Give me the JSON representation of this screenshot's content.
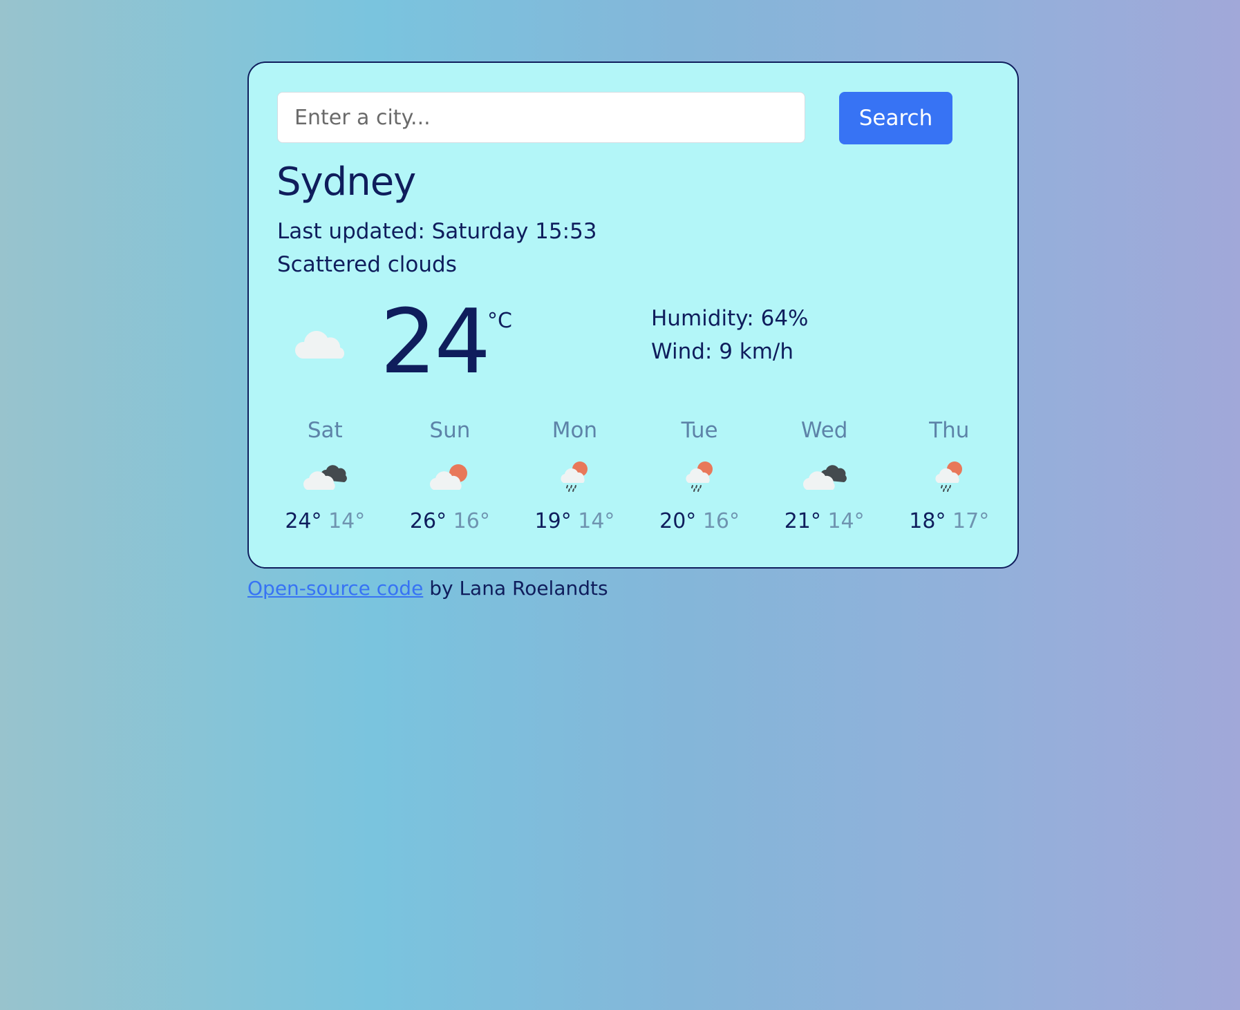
{
  "search": {
    "placeholder": "Enter a city...",
    "button_label": "Search"
  },
  "current": {
    "city": "Sydney",
    "last_updated": "Last updated: Saturday 15:53",
    "description": "Scattered clouds",
    "icon": "cloud-icon",
    "temperature": "24",
    "unit": "°C",
    "humidity": "Humidity: 64%",
    "wind": "Wind: 9 km/h"
  },
  "forecast": [
    {
      "day": "Sat",
      "icon": "broken-clouds-icon",
      "max": "24°",
      "min": "14°"
    },
    {
      "day": "Sun",
      "icon": "few-clouds-day-icon",
      "max": "26°",
      "min": "16°"
    },
    {
      "day": "Mon",
      "icon": "rain-day-icon",
      "max": "19°",
      "min": "14°"
    },
    {
      "day": "Tue",
      "icon": "rain-day-icon",
      "max": "20°",
      "min": "16°"
    },
    {
      "day": "Wed",
      "icon": "broken-clouds-icon",
      "max": "21°",
      "min": "14°"
    },
    {
      "day": "Thu",
      "icon": "rain-day-icon",
      "max": "18°",
      "min": "17°"
    }
  ],
  "footer": {
    "link_text": "Open-source code",
    "text": " by Lana Roelandts"
  },
  "colors": {
    "text": "#0f1d5c",
    "card_background": "#b3f6f8",
    "accent": "#3773f4",
    "muted": "#6f94b0"
  }
}
